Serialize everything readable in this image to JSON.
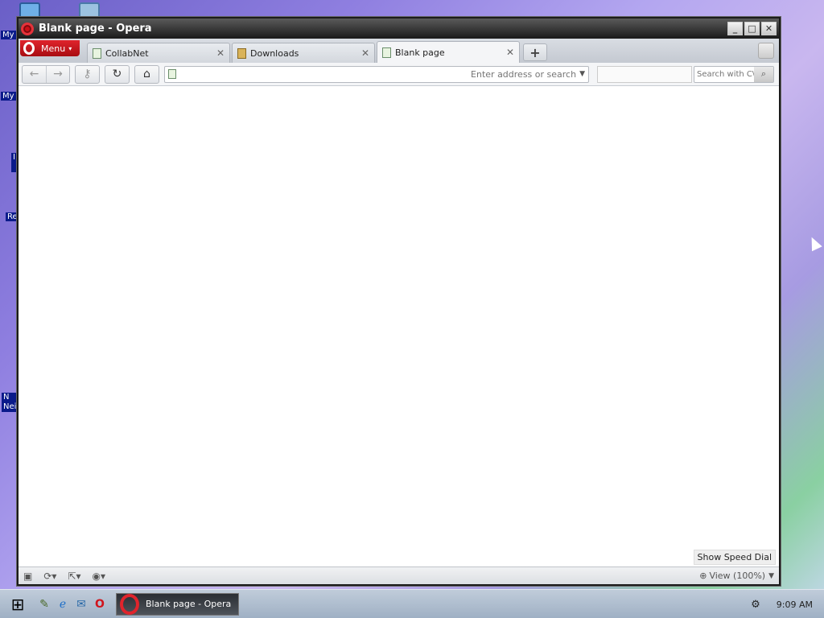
{
  "desktop": {
    "icons": [
      {
        "label": "My",
        "id": "my-computer"
      },
      {
        "label": "My I",
        "id": "my-documents"
      },
      {
        "label": "I E",
        "id": "internet-explorer"
      },
      {
        "label": "Re",
        "id": "recycle-bin"
      },
      {
        "label": "N Neig",
        "id": "network-neighborhood"
      }
    ]
  },
  "window": {
    "title": "Blank page - Opera",
    "controls": {
      "minimize": "_",
      "maximize": "□",
      "close": "✕"
    }
  },
  "menu": {
    "label": "Menu"
  },
  "tabs": [
    {
      "label": "CollabNet",
      "icon": "page-icon",
      "active": false
    },
    {
      "label": "Downloads",
      "icon": "download-icon",
      "active": false
    },
    {
      "label": "Blank page",
      "icon": "page-icon",
      "active": true
    }
  ],
  "toolbar": {
    "address_placeholder": "Enter address or search",
    "search_placeholder": "Search with C\\"
  },
  "content": {
    "speed_dial_label": "Show Speed Dial"
  },
  "statusbar": {
    "zoom_label": "View (100%)"
  },
  "taskbar": {
    "task_label": "Blank page - Opera",
    "time": "9:09 AM"
  }
}
